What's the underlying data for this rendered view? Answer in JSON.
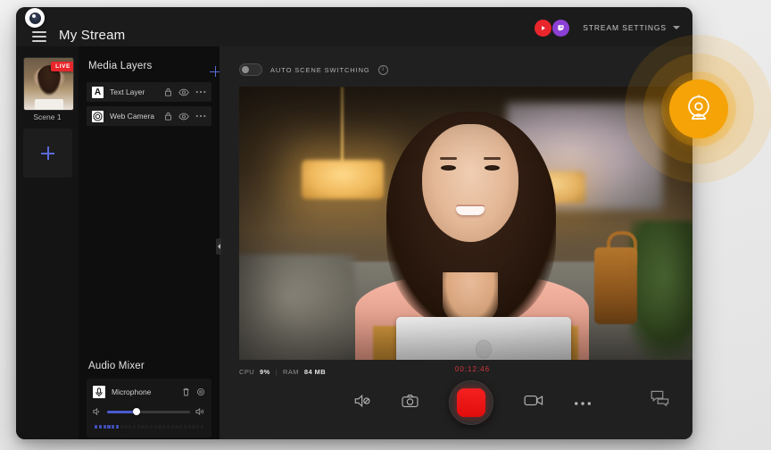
{
  "app": {
    "logo_icon": "eye-logo-icon",
    "title": "My Stream",
    "menu_icon": "hamburger-menu-icon"
  },
  "header": {
    "platforms": [
      {
        "name": "youtube",
        "icon": "youtube-icon",
        "color": "#e8262c"
      },
      {
        "name": "twitch",
        "icon": "twitch-icon",
        "color": "#8b3fd4"
      }
    ],
    "stream_settings_label": "STREAM SETTINGS",
    "stream_settings_chevron": "chevron-down-icon"
  },
  "scenes": {
    "items": [
      {
        "label": "Scene 1",
        "badge": "LIVE",
        "live": true
      }
    ],
    "add_scene_icon": "plus-icon"
  },
  "layers": {
    "title": "Media Layers",
    "add_icon": "plus-icon",
    "items": [
      {
        "name": "Text Layer",
        "icon": "text-layer-icon",
        "glyph": "A",
        "lock_icon": "lock-icon",
        "visibility_icon": "eye-icon",
        "more_icon": "ellipsis-icon"
      },
      {
        "name": "Web Camera",
        "icon": "web-camera-icon",
        "glyph": "",
        "lock_icon": "lock-icon",
        "visibility_icon": "eye-icon",
        "more_icon": "ellipsis-icon"
      }
    ]
  },
  "mixer": {
    "title": "Audio Mixer",
    "channel": {
      "name": "Microphone",
      "icon": "microphone-icon",
      "delete_icon": "trash-icon",
      "settings_icon": "gear-icon",
      "volume_percent": 35,
      "volume_low_icon": "volume-low-icon",
      "volume_high_icon": "volume-high-icon",
      "meter_segments": 26,
      "meter_active": 6
    }
  },
  "stage": {
    "auto_scene_switching": {
      "label": "AUTO SCENE SWITCHING",
      "enabled": false,
      "info_icon": "info-icon",
      "info_glyph": "i"
    },
    "collapse_handle_icon": "chevron-right-icon",
    "stats": {
      "cpu_label": "CPU",
      "cpu_value": "9%",
      "separator": "|",
      "ram_label": "RAM",
      "ram_value": "84 MB"
    },
    "timer": "00:12:46",
    "timer_color": "#d0353b"
  },
  "controls": {
    "buttons": [
      {
        "name": "mute-audio-button",
        "icon": "speaker-mute-icon"
      },
      {
        "name": "snapshot-button",
        "icon": "camera-icon"
      },
      {
        "name": "record-button",
        "icon": "record-icon"
      },
      {
        "name": "video-source-button",
        "icon": "video-camera-icon"
      },
      {
        "name": "more-options-button",
        "icon": "ellipsis-icon"
      }
    ],
    "chat_button": {
      "name": "chat-button",
      "icon": "chat-bubbles-icon"
    },
    "record_color": "#e00d0d"
  },
  "overlay": {
    "webcam_badge": {
      "icon": "webcam-icon",
      "color": "#f5a307",
      "rings": 3
    }
  }
}
